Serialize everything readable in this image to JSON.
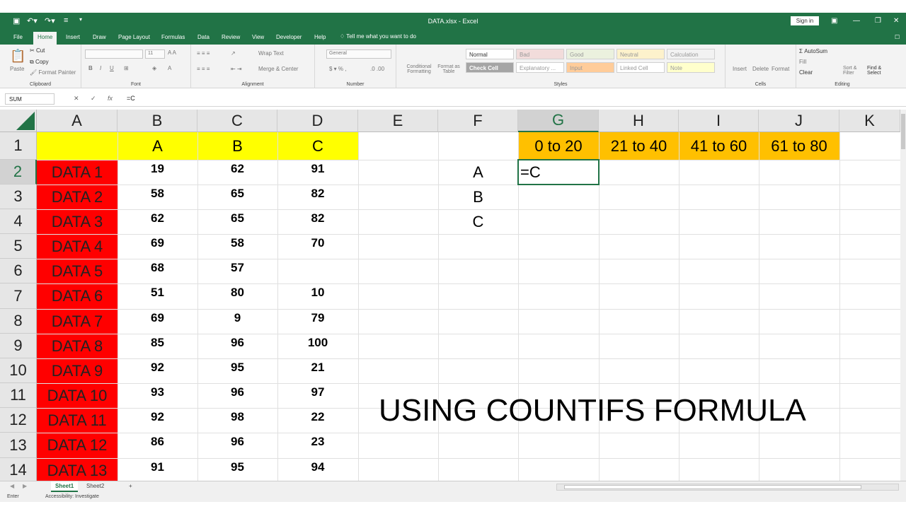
{
  "window": {
    "title": "DATA.xlsx - Excel",
    "signin_label": "Sign in",
    "quick_access": [
      "save-icon",
      "undo-icon",
      "redo-icon",
      "customize-icon"
    ]
  },
  "menu": {
    "tabs": [
      "File",
      "Home",
      "Insert",
      "Draw",
      "Page Layout",
      "Formulas",
      "Data",
      "Review",
      "View",
      "Developer",
      "Help"
    ],
    "active": "Home",
    "tell_me": "Tell me what you want to do"
  },
  "ribbon": {
    "clipboard": {
      "paste": "Paste",
      "cut": "Cut",
      "copy": "Copy",
      "format_painter": "Format Painter",
      "label": "Clipboard"
    },
    "font": {
      "size": "11",
      "label": "Font"
    },
    "alignment": {
      "wrap_text": "Wrap Text",
      "merge": "Merge & Center",
      "label": "Alignment"
    },
    "number": {
      "format": "General",
      "label": "Number"
    },
    "styles": {
      "conditional": "Conditional Formatting",
      "format_table": "Format as Table",
      "cells": [
        {
          "name": "Normal",
          "bg": "#ffffff"
        },
        {
          "name": "Bad",
          "bg": "#f2dcdb"
        },
        {
          "name": "Good",
          "bg": "#ebf1de"
        },
        {
          "name": "Neutral",
          "bg": "#fdf2cc"
        },
        {
          "name": "Calculation",
          "bg": "#f2f2f2"
        },
        {
          "name": "Check Cell",
          "bg": "#a5a5a5"
        },
        {
          "name": "Explanatory ...",
          "bg": "#ffffff"
        },
        {
          "name": "Input",
          "bg": "#ffcc99"
        },
        {
          "name": "Linked Cell",
          "bg": "#ffffff"
        },
        {
          "name": "Note",
          "bg": "#ffffcc"
        }
      ],
      "label": "Styles"
    },
    "cells": {
      "insert": "Insert",
      "delete": "Delete",
      "format": "Format",
      "label": "Cells"
    },
    "editing": {
      "autosum": "AutoSum",
      "fill": "Fill",
      "clear": "Clear",
      "sort_filter": "Sort & Filter",
      "find_select": "Find & Select",
      "label": "Editing"
    }
  },
  "formula_bar": {
    "name_box": "SUM",
    "cancel": "✕",
    "enter": "✓",
    "fx": "fx",
    "formula": "=C"
  },
  "sheet": {
    "columns": [
      "A",
      "B",
      "C",
      "D",
      "E",
      "F",
      "G",
      "H",
      "I",
      "J",
      "K"
    ],
    "rows": [
      "1",
      "2",
      "3",
      "4",
      "5",
      "6",
      "7",
      "8",
      "9",
      "10",
      "11",
      "12",
      "13",
      "14"
    ],
    "header_row": [
      "",
      "A",
      "B",
      "C"
    ],
    "data": [
      [
        "DATA 1",
        "19",
        "62",
        "91"
      ],
      [
        "DATA 2",
        "58",
        "65",
        "82"
      ],
      [
        "DATA 3",
        "62",
        "65",
        "82"
      ],
      [
        "DATA 4",
        "69",
        "58",
        "70"
      ],
      [
        "DATA 5",
        "68",
        "57",
        ""
      ],
      [
        "DATA 6",
        "51",
        "80",
        "10"
      ],
      [
        "DATA 7",
        "69",
        "9",
        "79"
      ],
      [
        "DATA 8",
        "85",
        "96",
        "100"
      ],
      [
        "DATA 9",
        "92",
        "95",
        "21"
      ],
      [
        "DATA 10",
        "93",
        "96",
        "97"
      ],
      [
        "DATA 11",
        "92",
        "98",
        "22"
      ],
      [
        "DATA 12",
        "86",
        "96",
        "23"
      ],
      [
        "DATA 13",
        "91",
        "95",
        "94"
      ]
    ],
    "range_headers": [
      "0 to 20",
      "21 to 40",
      "41 to 60",
      "61 to 80"
    ],
    "categories": [
      "A",
      "B",
      "C"
    ],
    "active_cell": "G2",
    "active_cell_value": "=C",
    "colors": {
      "label_fill": "#ff0000",
      "header_fill": "#ffff00",
      "range_fill": "#ffc000",
      "accent": "#217346"
    }
  },
  "caption": "USING COUNTIFS FORMULA",
  "tabs": {
    "sheets": [
      "Sheet1",
      "Sheet2"
    ],
    "active": "Sheet1",
    "add": "+"
  },
  "status": {
    "mode": "Enter",
    "accessibility": "Accessibility: Investigate"
  }
}
